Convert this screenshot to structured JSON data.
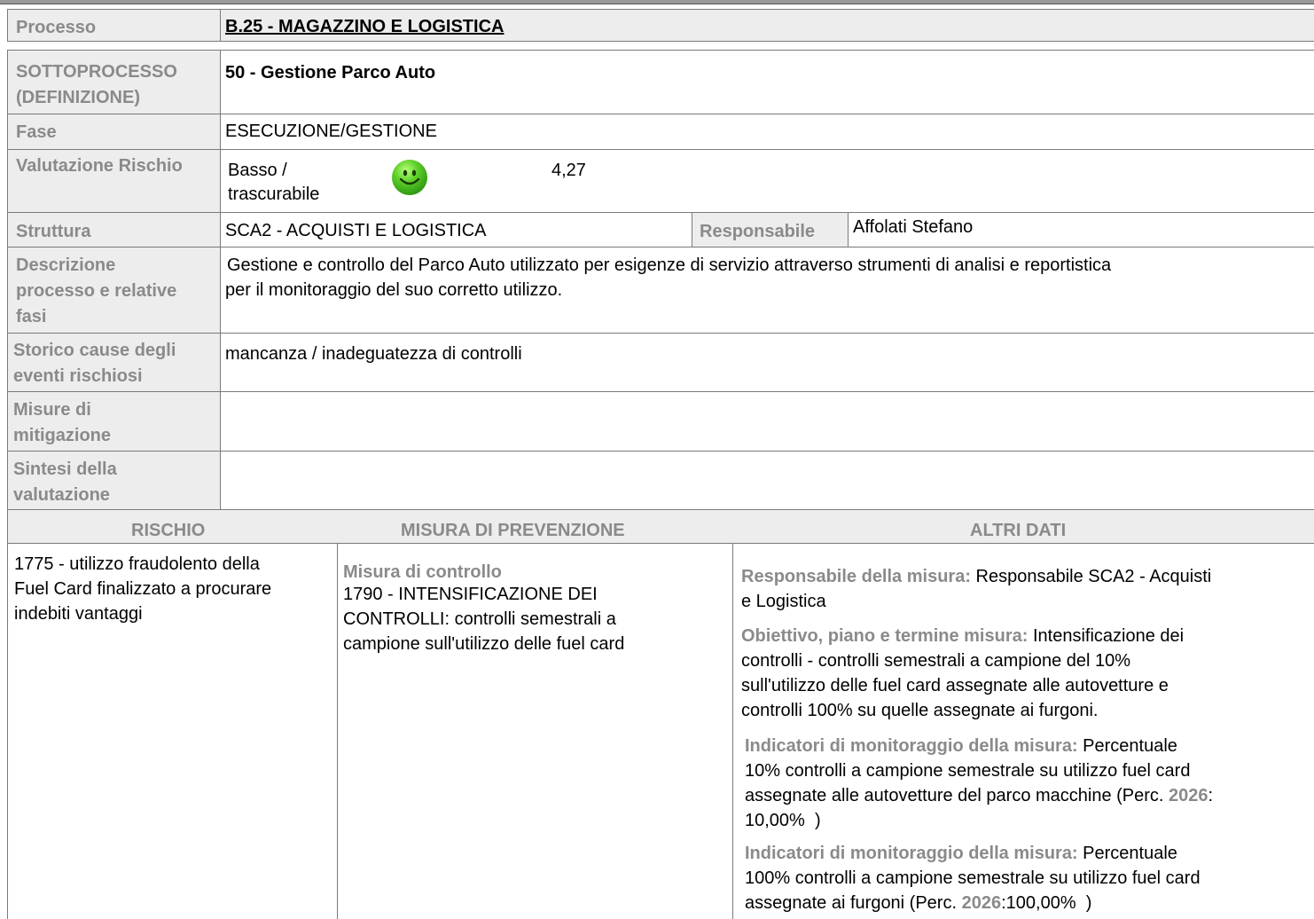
{
  "processo": {
    "label": "Processo",
    "value": "B.25 - MAGAZZINO E LOGISTICA"
  },
  "sottoprocesso": {
    "label_line1": "SOTTOPROCESSO",
    "label_line2": "(DEFINIZIONE)",
    "value": "50 - Gestione Parco Auto"
  },
  "fase": {
    "label": "Fase",
    "value": "ESECUZIONE/GESTIONE"
  },
  "valutazione": {
    "label": "Valutazione Rischio",
    "level_line1": "Basso /",
    "level_line2": "trascurabile",
    "icon": "smiley-green-icon",
    "score": "4,27"
  },
  "struttura": {
    "label": "Struttura",
    "value": "SCA2 - ACQUISTI E LOGISTICA",
    "responsabile_label": "Responsabile",
    "responsabile_value": "Affolati Stefano"
  },
  "descrizione": {
    "label_lines": [
      "Descrizione",
      "processo e relative",
      "fasi"
    ],
    "value_lines": [
      "Gestione e controllo del Parco Auto utilizzato per esigenze di servizio attraverso strumenti di analisi e reportistica",
      "per il monitoraggio del suo corretto utilizzo."
    ]
  },
  "storico": {
    "label_lines": [
      "Storico cause degli",
      "eventi rischiosi"
    ],
    "value": "mancanza / inadeguatezza di controlli"
  },
  "misure": {
    "label_lines": [
      "Misure di",
      "mitigazione"
    ],
    "value": ""
  },
  "sintesi": {
    "label_lines": [
      "Sintesi della",
      "valutazione"
    ],
    "value": ""
  },
  "table": {
    "headers": [
      "RISCHIO",
      "MISURA DI PREVENZIONE",
      "ALTRI DATI"
    ],
    "rischio_lines": [
      "1775 - utilizzo fraudolento della",
      "Fuel Card finalizzato a procurare",
      "indebiti vantaggi"
    ],
    "misura_type": "Misura di controllo",
    "misura_lines": [
      "1790 - INTENSIFICAZIONE DEI",
      "CONTROLLI: controlli semestrali a",
      "campione sull'utilizzo delle fuel card"
    ],
    "altri": {
      "resp_label": "Responsabile della misura:",
      "resp_line1": " Responsabile SCA2 - Acquisti",
      "resp_line2": "e Logistica",
      "obiettivo_label": "Obiettivo, piano e termine misura:",
      "obiettivo_line1": " Intensificazione dei",
      "obiettivo_lines": [
        "controlli - controlli semestrali a campione del 10%",
        "sull'utilizzo delle fuel card assegnate alle autovetture e",
        "controlli 100% su quelle assegnate ai furgoni."
      ],
      "ind1_label": "Indicatori di monitoraggio della misura:",
      "ind1_line1": " Percentuale",
      "ind1_lines": [
        "10% controlli a campione semestrale su utilizzo fuel card",
        "assegnate alle autovetture del parco macchine (Perc. "
      ],
      "ind1_year": "2026",
      "ind1_colon": ":",
      "ind1_value": "10,00%  )",
      "ind2_label": "Indicatori di monitoraggio della misura:",
      "ind2_line1": " Percentuale",
      "ind2_lines": [
        "100% controlli a campione semestrale su utilizzo fuel card"
      ],
      "ind2_last_prefix": "assegnate ai furgoni (Perc. ",
      "ind2_year": "2026",
      "ind2_value": ":100,00%  )"
    }
  }
}
